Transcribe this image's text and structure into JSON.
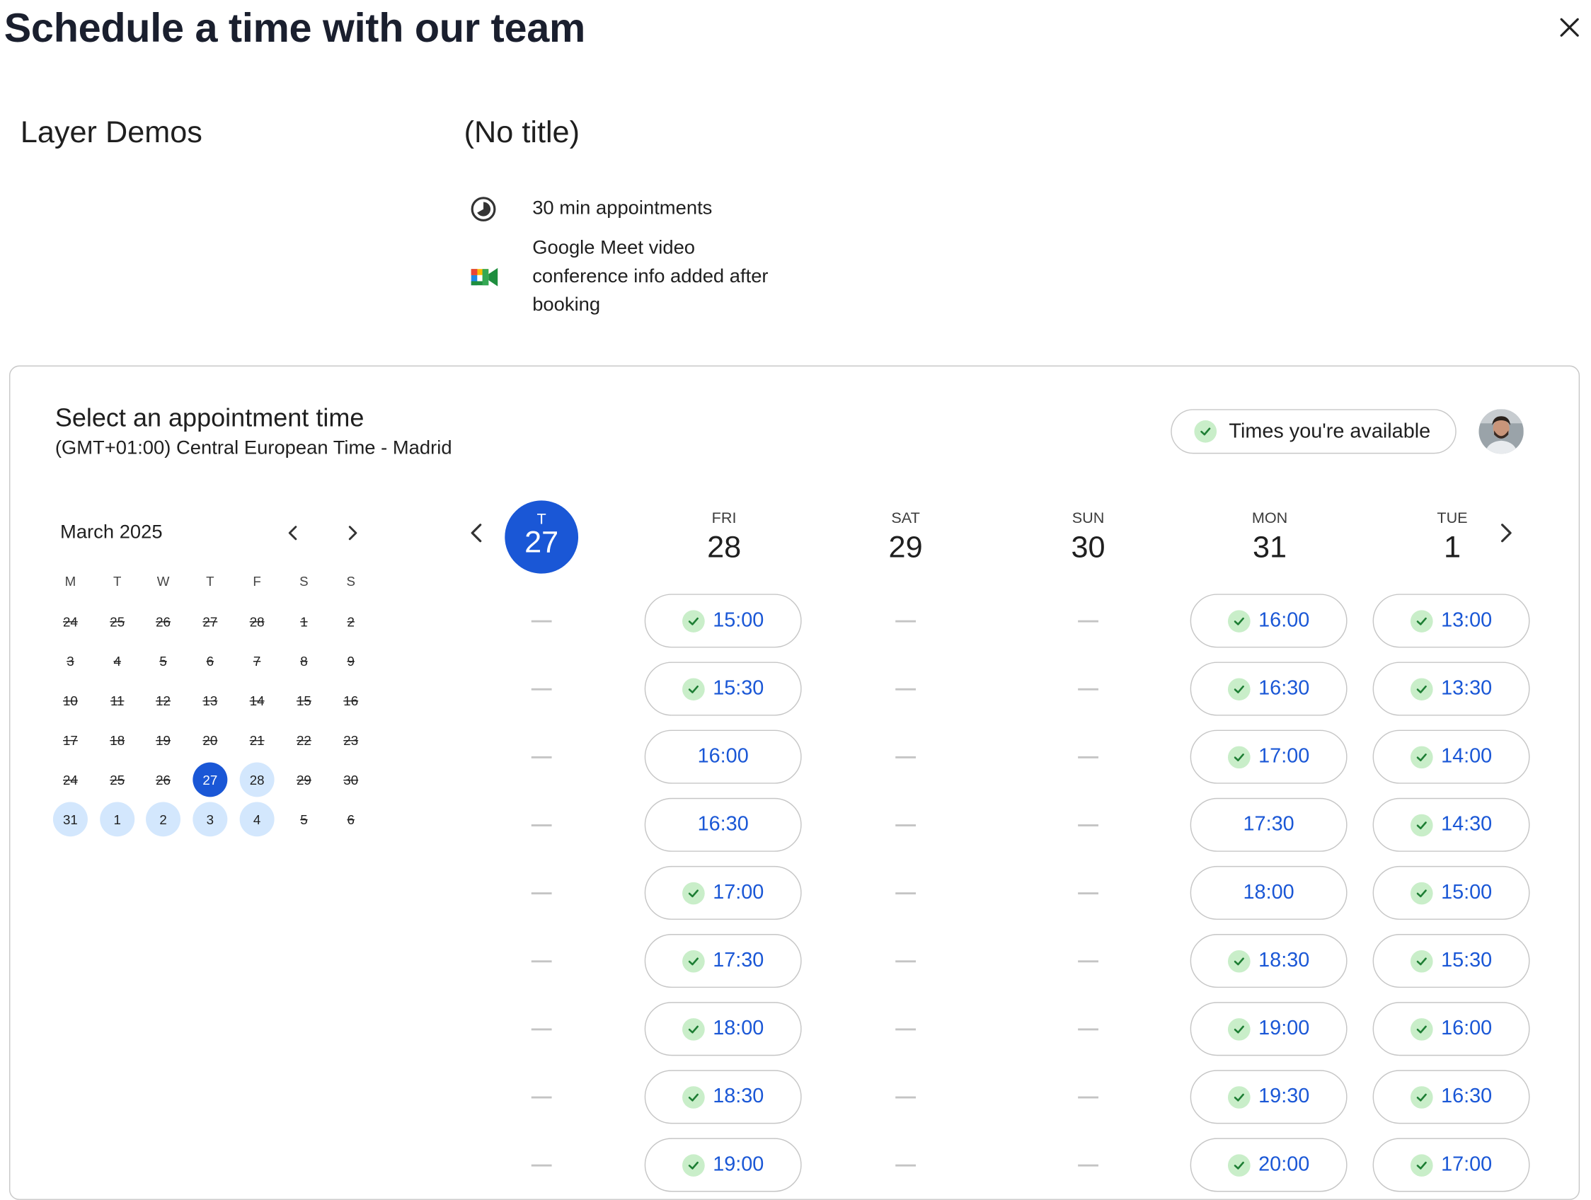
{
  "page": {
    "title": "Schedule a time with our team"
  },
  "icons": {
    "close": "close-icon",
    "duration": "clock-icon",
    "meet": "google-meet-icon",
    "check": "check-icon",
    "prev": "chevron-left-icon",
    "next": "chevron-right-icon"
  },
  "event": {
    "organizer": "Layer Demos",
    "title": "(No title)",
    "duration": "30 min appointments",
    "conference_lines": [
      "Google Meet video",
      "conference info added after",
      "booking"
    ]
  },
  "booking": {
    "heading": "Select an appointment time",
    "timezone": "(GMT+01:00) Central European Time - Madrid",
    "availability_label": "Times you're available"
  },
  "mini_calendar": {
    "month": "March 2025",
    "weekdays": [
      "M",
      "T",
      "W",
      "T",
      "F",
      "S",
      "S"
    ],
    "weeks": [
      [
        {
          "d": "24",
          "s": "struck"
        },
        {
          "d": "25",
          "s": "struck"
        },
        {
          "d": "26",
          "s": "struck"
        },
        {
          "d": "27",
          "s": "struck"
        },
        {
          "d": "28",
          "s": "struck"
        },
        {
          "d": "1",
          "s": "struck"
        },
        {
          "d": "2",
          "s": "struck"
        }
      ],
      [
        {
          "d": "3",
          "s": "struck"
        },
        {
          "d": "4",
          "s": "struck"
        },
        {
          "d": "5",
          "s": "struck"
        },
        {
          "d": "6",
          "s": "struck"
        },
        {
          "d": "7",
          "s": "struck"
        },
        {
          "d": "8",
          "s": "struck"
        },
        {
          "d": "9",
          "s": "struck"
        }
      ],
      [
        {
          "d": "10",
          "s": "struck"
        },
        {
          "d": "11",
          "s": "struck"
        },
        {
          "d": "12",
          "s": "struck"
        },
        {
          "d": "13",
          "s": "struck"
        },
        {
          "d": "14",
          "s": "struck"
        },
        {
          "d": "15",
          "s": "struck"
        },
        {
          "d": "16",
          "s": "struck"
        }
      ],
      [
        {
          "d": "17",
          "s": "struck"
        },
        {
          "d": "18",
          "s": "struck"
        },
        {
          "d": "19",
          "s": "struck"
        },
        {
          "d": "20",
          "s": "struck"
        },
        {
          "d": "21",
          "s": "struck"
        },
        {
          "d": "22",
          "s": "struck"
        },
        {
          "d": "23",
          "s": "struck"
        }
      ],
      [
        {
          "d": "24",
          "s": "struck"
        },
        {
          "d": "25",
          "s": "struck"
        },
        {
          "d": "26",
          "s": "struck"
        },
        {
          "d": "27",
          "s": "selected"
        },
        {
          "d": "28",
          "s": "avail"
        },
        {
          "d": "29",
          "s": "struck"
        },
        {
          "d": "30",
          "s": "struck"
        }
      ],
      [
        {
          "d": "31",
          "s": "avail"
        },
        {
          "d": "1",
          "s": "avail"
        },
        {
          "d": "2",
          "s": "avail"
        },
        {
          "d": "3",
          "s": "avail"
        },
        {
          "d": "4",
          "s": "avail"
        },
        {
          "d": "5",
          "s": "struck"
        },
        {
          "d": "6",
          "s": "struck"
        }
      ]
    ]
  },
  "week": {
    "today": {
      "dow": "T",
      "num": "27"
    },
    "days": [
      {
        "dow": "FRI",
        "num": "28"
      },
      {
        "dow": "SAT",
        "num": "29"
      },
      {
        "dow": "SUN",
        "num": "30"
      },
      {
        "dow": "MON",
        "num": "31"
      },
      {
        "dow": "TUE",
        "num": "1"
      }
    ],
    "columns": [
      {
        "slots": []
      },
      {
        "slots": [
          {
            "time": "15:00",
            "check": true
          },
          {
            "time": "15:30",
            "check": true
          },
          {
            "time": "16:00",
            "check": false
          },
          {
            "time": "16:30",
            "check": false
          },
          {
            "time": "17:00",
            "check": true
          },
          {
            "time": "17:30",
            "check": true
          },
          {
            "time": "18:00",
            "check": true
          },
          {
            "time": "18:30",
            "check": true
          },
          {
            "time": "19:00",
            "check": true
          }
        ]
      },
      {
        "slots": []
      },
      {
        "slots": []
      },
      {
        "slots": [
          {
            "time": "16:00",
            "check": true
          },
          {
            "time": "16:30",
            "check": true
          },
          {
            "time": "17:00",
            "check": true
          },
          {
            "time": "17:30",
            "check": false
          },
          {
            "time": "18:00",
            "check": false
          },
          {
            "time": "18:30",
            "check": true
          },
          {
            "time": "19:00",
            "check": true
          },
          {
            "time": "19:30",
            "check": true
          },
          {
            "time": "20:00",
            "check": true
          }
        ]
      },
      {
        "slots": [
          {
            "time": "13:00",
            "check": true
          },
          {
            "time": "13:30",
            "check": true
          },
          {
            "time": "14:00",
            "check": true
          },
          {
            "time": "14:30",
            "check": true
          },
          {
            "time": "15:00",
            "check": true
          },
          {
            "time": "15:30",
            "check": true
          },
          {
            "time": "16:00",
            "check": true
          },
          {
            "time": "16:30",
            "check": true
          },
          {
            "time": "17:00",
            "check": true
          }
        ]
      }
    ]
  },
  "colors": {
    "accent": "#1a57d6",
    "available_day": "#d3e7fd",
    "check_bg": "#c9eec9",
    "check_fg": "#1e7e34"
  }
}
